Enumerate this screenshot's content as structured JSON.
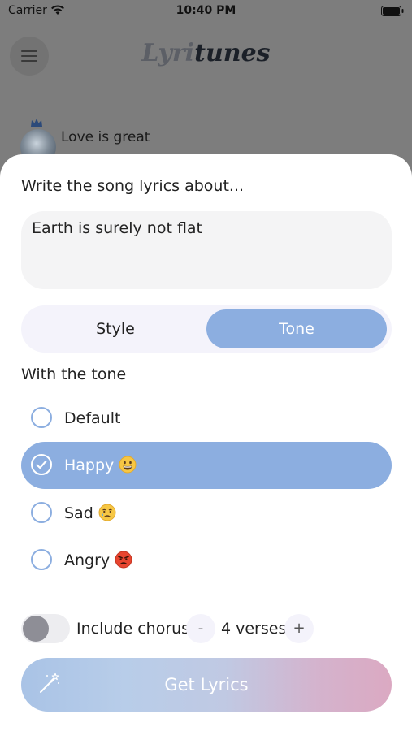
{
  "status_bar": {
    "carrier": "Carrier",
    "time": "10:40 PM"
  },
  "header": {
    "logo_part1": "Lyri",
    "logo_part2": "tunes"
  },
  "background_list": {
    "item_title": "Love is great"
  },
  "sheet": {
    "prompt": "Write the song lyrics about...",
    "topic_value": "Earth is surely not flat",
    "segments": {
      "style": "Style",
      "tone": "Tone",
      "selected": "Tone"
    },
    "tone_section_title": "With the tone",
    "tones": [
      {
        "label": "Default",
        "emoji": "",
        "selected": false
      },
      {
        "label": "Happy",
        "emoji": "grinning-face",
        "selected": true
      },
      {
        "label": "Sad",
        "emoji": "crying-face",
        "selected": false
      },
      {
        "label": "Angry",
        "emoji": "angry-face",
        "selected": false
      }
    ],
    "chorus": {
      "label": "Include chorus",
      "enabled": false
    },
    "verses": {
      "minus": "-",
      "plus": "+",
      "count_text": "4 verses"
    },
    "cta": {
      "label": "Get Lyrics",
      "icon": "magic-wand-icon"
    }
  },
  "colors": {
    "accent": "#8caee0",
    "overlay": "#7d7d7d"
  }
}
